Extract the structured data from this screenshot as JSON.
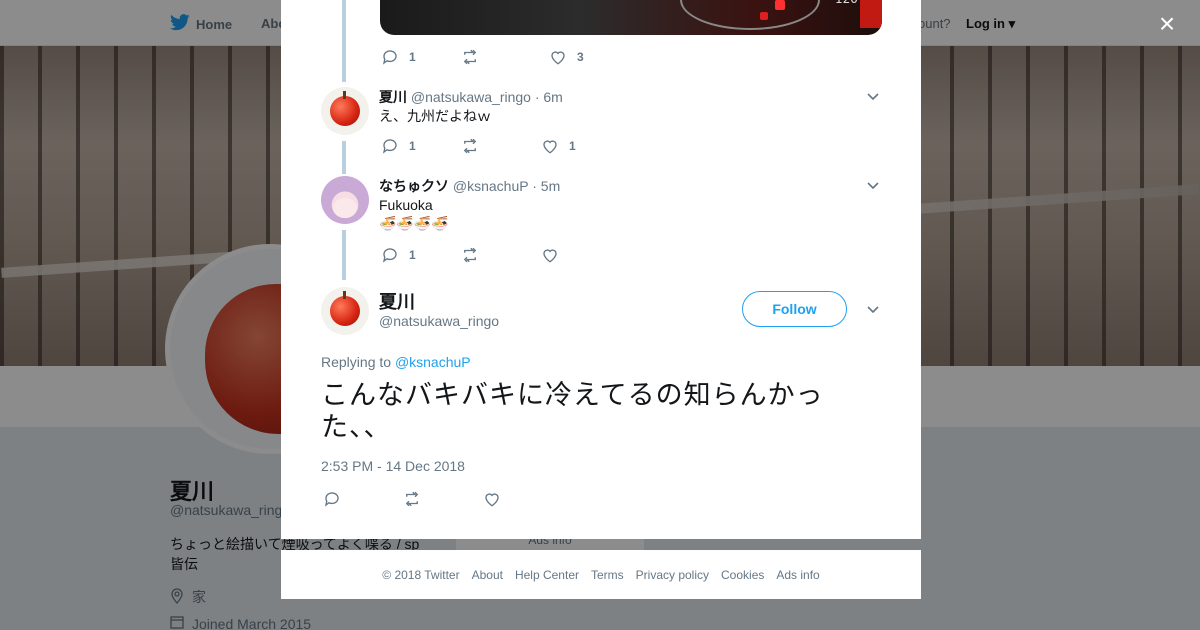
{
  "background": {
    "nav": {
      "home_label": "Home",
      "about_label": "Abo",
      "account_text": "ccount?",
      "login_label": "Log in"
    },
    "profile": {
      "name": "夏川",
      "handle": "@natsukawa_ringo",
      "bio": "ちょっと絵描いて煙吸ってよく喋る / sp 皆伝",
      "location": "家",
      "joined": "Joined March 2015",
      "ads_info": "Ads info"
    }
  },
  "modal": {
    "close_label": "×",
    "top_tweet_actions": {
      "replies": "1",
      "retweets": "",
      "likes": "3"
    },
    "replies": [
      {
        "name": "夏川",
        "handle": "@natsukawa_ringo",
        "time": "· 6m",
        "text": "え、九州だよねｗ",
        "emoji": "",
        "actions": {
          "replies": "1",
          "retweets": "",
          "likes": "1"
        }
      },
      {
        "name": "なちゅクソ",
        "handle": "@ksnachuP",
        "time": "· 5m",
        "text": "Fukuoka",
        "emoji": "🍜🍜🍜🍜",
        "actions": {
          "replies": "1",
          "retweets": "",
          "likes": ""
        }
      }
    ],
    "main_tweet": {
      "name": "夏川",
      "handle": "@natsukawa_ringo",
      "follow_label": "Follow",
      "replying_prefix": "Replying to",
      "replying_to": "@ksnachuP",
      "text": "こんなバキバキに冷えてるの知らんかった、、",
      "timestamp": "2:53 PM - 14 Dec 2018"
    }
  },
  "footer": {
    "copyright": "© 2018 Twitter",
    "links": [
      "About",
      "Help Center",
      "Terms",
      "Privacy policy",
      "Cookies",
      "Ads info"
    ]
  },
  "colors": {
    "accent": "#1da1f2",
    "thread_line": "#b8cfe0",
    "muted_text": "#657786"
  }
}
